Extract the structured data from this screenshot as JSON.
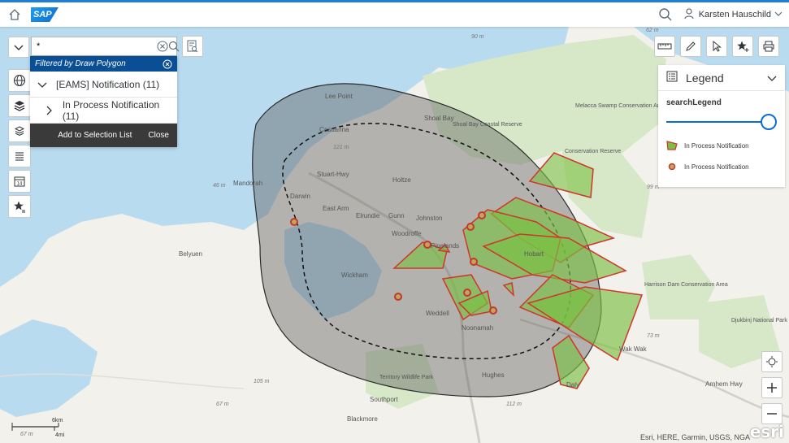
{
  "shell": {
    "user_name": "Karsten Hauschild",
    "logo_text": "SAP"
  },
  "search": {
    "value": "*",
    "placeholder": ""
  },
  "filter_panel": {
    "header": "Filtered by Draw Polygon",
    "group_label": "[EAMS] Notification (11)",
    "sub_label": "In Process Notification (11)",
    "add_button": "Add to Selection List",
    "close_button": "Close"
  },
  "legend": {
    "title": "Legend",
    "subtitle": "searchLegend",
    "items": [
      {
        "label": "In Process Notification",
        "symbol": "polygon"
      },
      {
        "label": "In Process Notification",
        "symbol": "point"
      }
    ]
  },
  "map_labels": {
    "lee_point": "Lee Point",
    "shoal_bay": "Shoal Bay",
    "shoal_bay_reserve": "Shoal Bay Coastal Reserve",
    "casuarina": "Casuarina",
    "stuart_hwy": "Stuart-Hwy",
    "holtze": "Holtze",
    "darwin": "Darwin",
    "mandorah": "Mandorah",
    "east_arm": "East Arm",
    "elrundie": "Elrundie",
    "gunn": "Gunn",
    "johnston": "Johnston",
    "woodroffe": "Woodroffe",
    "pinelands": "Pinelands",
    "hobart": "Hobart",
    "belyuen": "Belyuen",
    "wickham": "Wickham",
    "weddell": "Weddell",
    "noonamah": "Noonamah",
    "hughes": "Hughes",
    "territory_park": "Territory Wildlife Park",
    "southport": "Southport",
    "blackmore": "Blackmore",
    "melacca": "Melacca Swamp Conservation Area",
    "conservation_reserve": "Conservation Reserve",
    "harrison_dam": "Harrison Dam Conservation Area",
    "djukbinj": "Djukbinj National Park",
    "wak_wak": "Wak Wak",
    "daly": "Daly",
    "arnhem_hwy": "Arnhem Hwy",
    "elev_90": "90 m",
    "elev_62": "62 m",
    "elev_121": "121 m",
    "elev_46": "46 m",
    "elev_99": "99 m",
    "elev_73": "73 m",
    "elev_105": "105 m",
    "elev_67a": "67 m",
    "elev_112": "112 m",
    "elev_67b": "67 m"
  },
  "scale": {
    "km": "6km",
    "mi": "4mi"
  },
  "attribution": "Esri, HERE, Garmin, USGS, NGA",
  "esri_logo": "esri",
  "colors": {
    "accent": "#0a6ed1",
    "panel_header": "#0a4e95",
    "polygon_fill": "#7bc043",
    "polygon_stroke": "#d0352b",
    "water": "#b9dbf0"
  }
}
